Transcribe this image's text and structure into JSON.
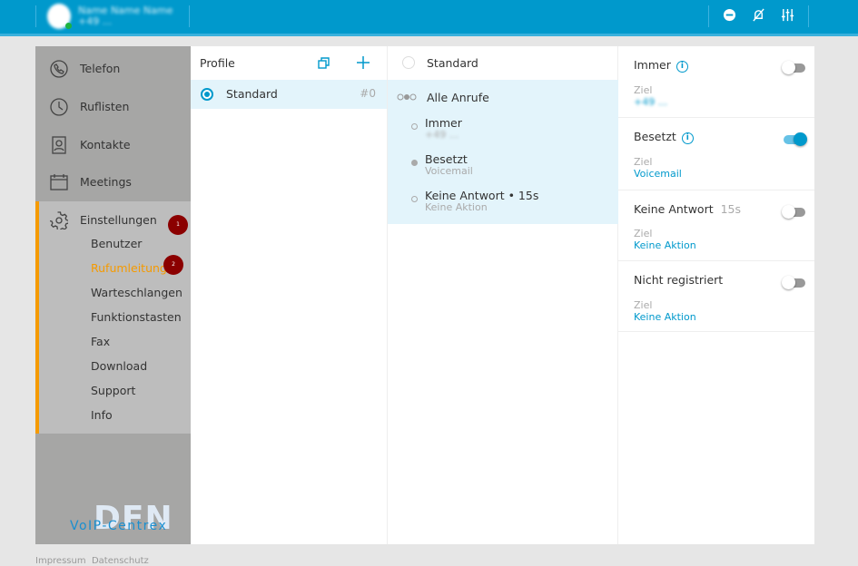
{
  "header": {
    "user_name": "Name Name Name",
    "user_number": "+49 ...",
    "icons": [
      "dnd-icon",
      "mute-icon",
      "settings-sliders-icon"
    ]
  },
  "sidebar": {
    "nav": [
      {
        "label": "Telefon",
        "icon": "phone-icon"
      },
      {
        "label": "Ruflisten",
        "icon": "clock-icon"
      },
      {
        "label": "Kontakte",
        "icon": "contact-icon"
      },
      {
        "label": "Meetings",
        "icon": "calendar-icon"
      }
    ],
    "settings": {
      "label": "Einstellungen",
      "badge": "1",
      "items": [
        {
          "label": "Benutzer"
        },
        {
          "label": "Rufumleitung",
          "badge": "2",
          "active": true
        },
        {
          "label": "Warteschlangen"
        },
        {
          "label": "Funktionstasten"
        },
        {
          "label": "Fax"
        },
        {
          "label": "Download"
        },
        {
          "label": "Support"
        },
        {
          "label": "Info"
        }
      ]
    },
    "logo_text": "DFN",
    "brand": "VoIP-Centrex"
  },
  "profiles": {
    "title": "Profile",
    "items": [
      {
        "name": "Standard",
        "code": "#0",
        "selected": true
      }
    ]
  },
  "profile_detail": {
    "name": "Standard",
    "group": "Alle Anrufe",
    "rules": [
      {
        "title": "Immer",
        "subtitle": "+49 ..."
      },
      {
        "title": "Besetzt",
        "subtitle": "Voicemail"
      },
      {
        "title": "Keine Antwort • 15s",
        "subtitle": "Keine Aktion"
      }
    ]
  },
  "rules": {
    "ziel_label": "Ziel",
    "items": [
      {
        "title": "Immer",
        "info": true,
        "enabled": false,
        "target": "+49 ..."
      },
      {
        "title": "Besetzt",
        "info": true,
        "enabled": true,
        "target": "Voicemail"
      },
      {
        "title": "Keine Antwort",
        "delay": "15s",
        "enabled": false,
        "target": "Keine Aktion"
      },
      {
        "title": "Nicht registriert",
        "enabled": false,
        "target": "Keine Aktion"
      }
    ]
  },
  "footer": {
    "impressum": "Impressum",
    "datenschutz": "Datenschutz"
  },
  "colors": {
    "header": "#0099cc",
    "accent": "#f59a00",
    "badge": "#8b0000"
  }
}
